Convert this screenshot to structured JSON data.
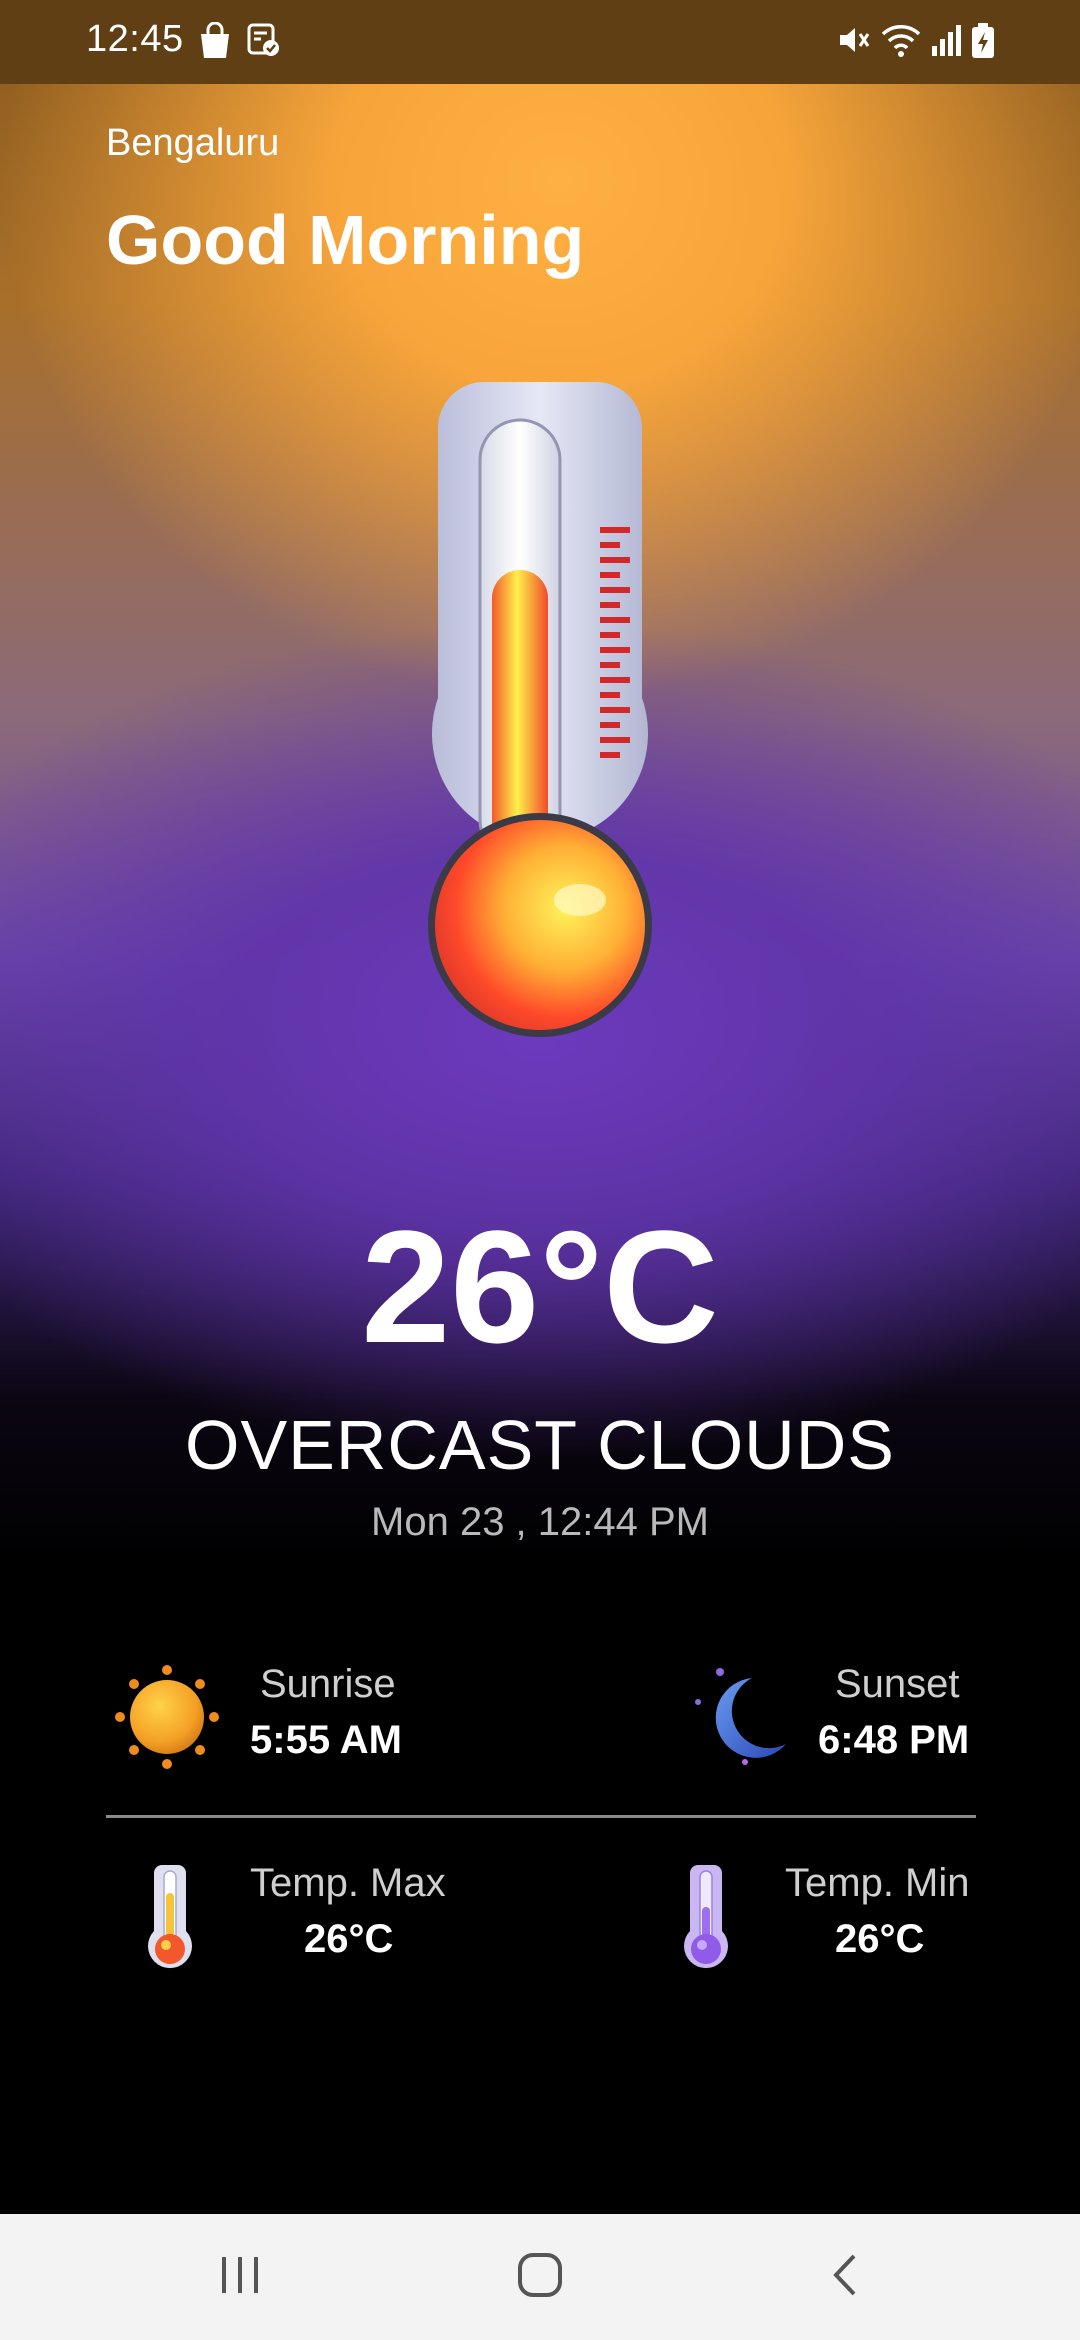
{
  "status_bar": {
    "time": "12:45",
    "left_icons": [
      "shopping-bag-icon",
      "clipboard-check-icon"
    ],
    "right_icons": [
      "mute-icon",
      "wifi-icon",
      "signal-icon",
      "battery-charging-icon"
    ]
  },
  "header": {
    "city": "Bengaluru",
    "greeting": "Good Morning"
  },
  "weather": {
    "temperature": "26°C",
    "condition": "OVERCAST CLOUDS",
    "datetime": "Mon 23 , 12:44 PM"
  },
  "stats": {
    "sunrise": {
      "label": "Sunrise",
      "value": "5:55 AM"
    },
    "sunset": {
      "label": "Sunset",
      "value": "6:48 PM"
    },
    "temp_max": {
      "label": "Temp. Max",
      "value": "26°C"
    },
    "temp_min": {
      "label": "Temp. Min",
      "value": "26°C"
    }
  },
  "nav": {
    "buttons": [
      "recent-apps",
      "home",
      "back"
    ]
  },
  "colors": {
    "status_bar": "#5f3f13",
    "warm_top": "#ffb042",
    "purple_mid": "#6c3abe",
    "bottom": "#000000",
    "nav_bar": "#f3f3f3"
  }
}
